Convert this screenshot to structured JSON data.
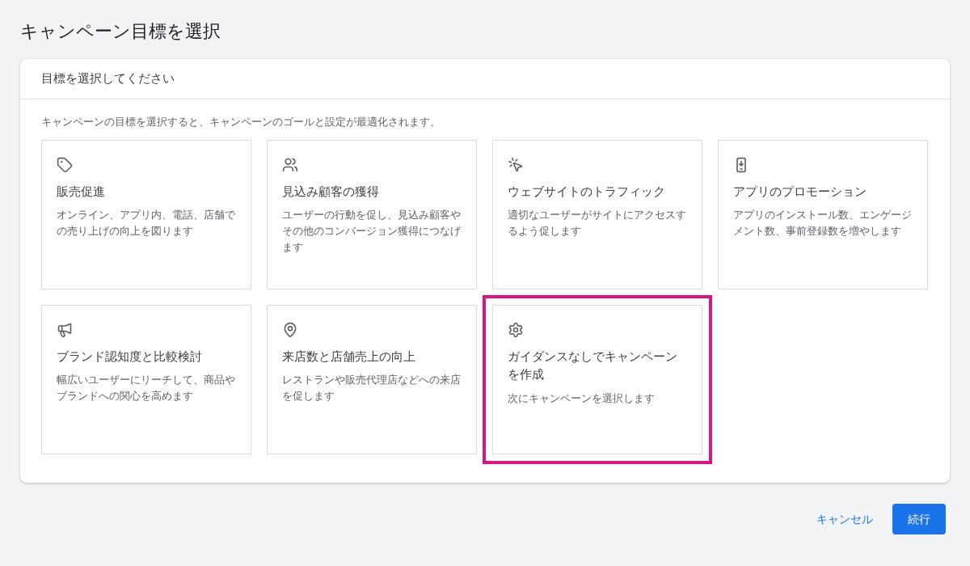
{
  "page_title": "キャンペーン目標を選択",
  "panel": {
    "heading": "目標を選択してください",
    "description": "キャンペーンの目標を選択すると、キャンペーンのゴールと設定が最適化されます。"
  },
  "goals": [
    {
      "kind": "tag",
      "title": "販売促進",
      "description": "オンライン、アプリ内、電話、店舗での売り上げの向上を図ります",
      "highlighted": false
    },
    {
      "kind": "people",
      "title": "見込み顧客の獲得",
      "description": "ユーザーの行動を促し、見込み顧客やその他のコンバージョン獲得につなげます",
      "highlighted": false
    },
    {
      "kind": "click",
      "title": "ウェブサイトのトラフィック",
      "description": "適切なユーザーがサイトにアクセスするよう促します",
      "highlighted": false
    },
    {
      "kind": "app",
      "title": "アプリのプロモーション",
      "description": "アプリのインストール数、エンゲージメント数、事前登録数を増やします",
      "highlighted": false
    },
    {
      "kind": "megaphone",
      "title": "ブランド認知度と比較検討",
      "description": "幅広いユーザーにリーチして、商品やブランドへの関心を高めます",
      "highlighted": false
    },
    {
      "kind": "pin",
      "title": "来店数と店舗売上の向上",
      "description": "レストランや販売代理店などへの来店を促します",
      "highlighted": false
    },
    {
      "kind": "gear",
      "title": "ガイダンスなしでキャンペーンを作成",
      "description": "次にキャンペーンを選択します",
      "highlighted": true
    }
  ],
  "buttons": {
    "cancel": "キャンセル",
    "continue": "続行"
  }
}
